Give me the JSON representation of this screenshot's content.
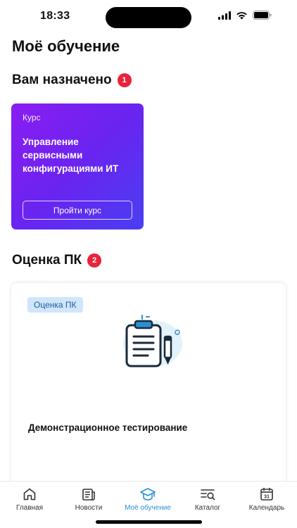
{
  "status": {
    "time": "18:33"
  },
  "page": {
    "title": "Моё обучение"
  },
  "assigned": {
    "title": "Вам назначено",
    "badge": "1",
    "card": {
      "type_label": "Курс",
      "title": "Управление сервисными конфигурациями ИТ",
      "button_label": "Пройти курс"
    }
  },
  "evaluation": {
    "title": "Оценка ПК",
    "badge": "2",
    "card": {
      "tag": "Оценка ПК",
      "title": "Демонстрационное тестирование"
    }
  },
  "tabs": [
    {
      "label": "Главная",
      "icon": "home-icon"
    },
    {
      "label": "Новости",
      "icon": "news-icon"
    },
    {
      "label": "Моё обучение",
      "icon": "graduation-cap-icon",
      "active": true
    },
    {
      "label": "Каталог",
      "icon": "catalog-search-icon"
    },
    {
      "label": "Календарь",
      "icon": "calendar-icon",
      "calendar_day": "31"
    }
  ],
  "colors": {
    "accent": "#2a8fd6",
    "badge": "#e8243b",
    "card_gradient_start": "#8a1df2",
    "card_gradient_end": "#4a3ef2",
    "tag_background": "#cfe6fc"
  }
}
